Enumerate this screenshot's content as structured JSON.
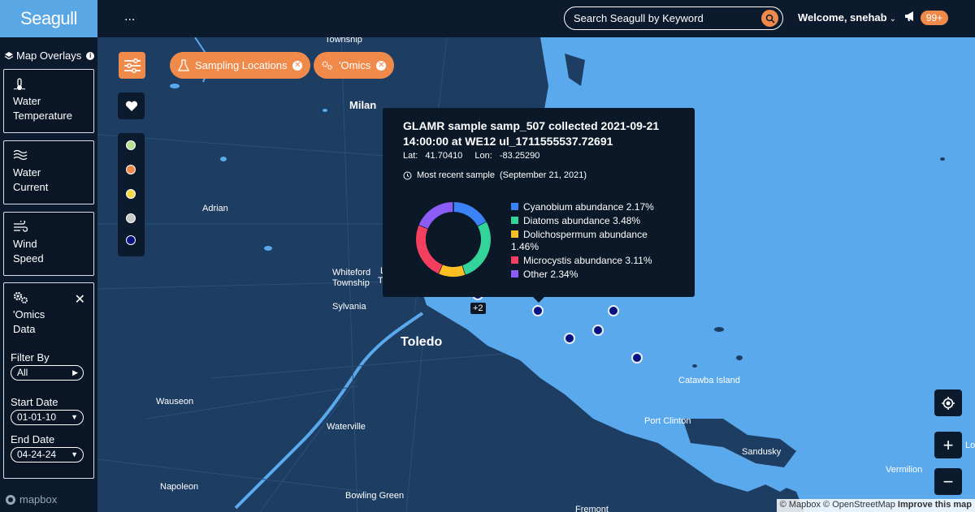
{
  "app": {
    "logo": "Seagull",
    "menu_dots": "..."
  },
  "search": {
    "placeholder": "Search Seagull by Keyword",
    "icon": "search-icon"
  },
  "user": {
    "welcome": "Welcome, snehab",
    "notifications_count": "99+"
  },
  "sidebar": {
    "title": "Map Overlays",
    "overlays": [
      {
        "line1": "Water",
        "line2": "Temperature",
        "icon": "thermometer-icon"
      },
      {
        "line1": "Water",
        "line2": "Current",
        "icon": "waves-icon"
      },
      {
        "line1": "Wind",
        "line2": "Speed",
        "icon": "wind-icon"
      }
    ],
    "omics": {
      "line1": "'Omics",
      "line2": "Data",
      "close": "✕",
      "filter_label": "Filter By",
      "filter_value": "All",
      "start_label": "Start Date",
      "start_value": "01-01-10",
      "end_label": "End Date",
      "end_value": "04-24-24"
    },
    "mapbox": "mapbox"
  },
  "map": {
    "chips": [
      {
        "label": "Sampling Locations",
        "icon": "flask-icon"
      },
      {
        "label": "'Omics",
        "icon": "gears-icon"
      }
    ],
    "legend_colors": [
      "#b9e08f",
      "#f08a4b",
      "#f5d949",
      "#c8c8c8",
      "#071382"
    ],
    "places": {
      "township": "Township",
      "milan": "Milan",
      "adrian": "Adrian",
      "whiteford": "Whiteford",
      "whiteford_township": "Township",
      "sylvania": "Sylvania",
      "toledo": "Toledo",
      "wauseon": "Wauseon",
      "waterville": "Waterville",
      "napoleon": "Napoleon",
      "bowling_green": "Bowling Green",
      "fremont": "Fremont",
      "catawba": "Catawba Island",
      "port_clinton": "Port Clinton",
      "sandusky": "Sandusky",
      "vermilion": "Vermilion",
      "lo": "Lo",
      "cut_l": "L",
      "cut_t": "T"
    },
    "cluster_label": "+2",
    "attribution": {
      "mapbox": "© Mapbox",
      "osm": "© OpenStreetMap",
      "improve": "Improve this map"
    },
    "zoom_in": "+",
    "zoom_out": "−"
  },
  "popup": {
    "title": "GLAMR sample samp_507 collected 2021-09-21 14:00:00 at WE12 ul_1711555537.72691",
    "lat_label": "Lat:",
    "lat": "41.70410",
    "lon_label": "Lon:",
    "lon": "-83.25290",
    "recent_label": "Most recent sample",
    "recent_date": "(September 21, 2021)",
    "legend": [
      {
        "label": "Cyanobium abundance 2.17%",
        "color": "#3b82f6"
      },
      {
        "label": "Diatoms abundance 3.48%",
        "color": "#34d399"
      },
      {
        "label": "Dolichospermum abundance 1.46%",
        "color": "#fbbf24"
      },
      {
        "label": "Microcystis abundance 3.11%",
        "color": "#f43f5e"
      },
      {
        "label": "Other 2.34%",
        "color": "#8b5cf6"
      }
    ]
  },
  "chart_data": {
    "type": "pie",
    "categories": [
      "Cyanobium abundance",
      "Diatoms abundance",
      "Dolichospermum abundance",
      "Microcystis abundance",
      "Other"
    ],
    "values": [
      2.17,
      3.48,
      1.46,
      3.11,
      2.34
    ],
    "colors": [
      "#3b82f6",
      "#34d399",
      "#fbbf24",
      "#f43f5e",
      "#8b5cf6"
    ],
    "donut": true
  }
}
